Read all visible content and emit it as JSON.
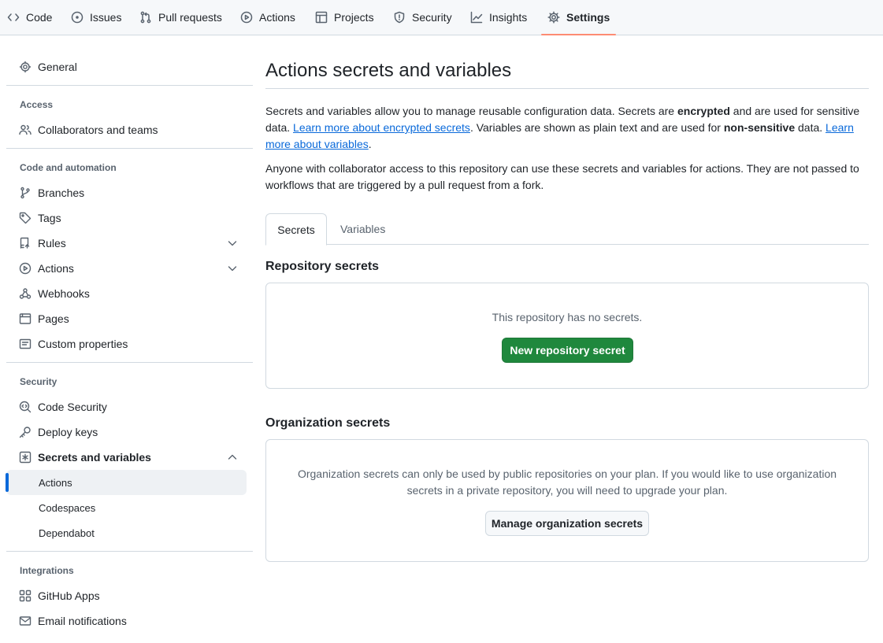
{
  "repo_nav": {
    "tabs": [
      {
        "label": "Code",
        "icon": "code-icon"
      },
      {
        "label": "Issues",
        "icon": "issue-icon"
      },
      {
        "label": "Pull requests",
        "icon": "pull-request-icon"
      },
      {
        "label": "Actions",
        "icon": "play-icon"
      },
      {
        "label": "Projects",
        "icon": "table-icon"
      },
      {
        "label": "Security",
        "icon": "shield-icon"
      },
      {
        "label": "Insights",
        "icon": "graph-icon"
      },
      {
        "label": "Settings",
        "icon": "gear-icon",
        "active": true
      }
    ]
  },
  "sidebar": {
    "general": "General",
    "groups": {
      "access": "Access",
      "code_automation": "Code and automation",
      "security": "Security",
      "integrations": "Integrations"
    },
    "items": {
      "collaborators": "Collaborators and teams",
      "branches": "Branches",
      "tags": "Tags",
      "rules": "Rules",
      "actions": "Actions",
      "webhooks": "Webhooks",
      "pages": "Pages",
      "custom_properties": "Custom properties",
      "code_security": "Code Security",
      "deploy_keys": "Deploy keys",
      "secrets_variables": "Secrets and variables",
      "sub_actions": "Actions",
      "sub_codespaces": "Codespaces",
      "sub_dependabot": "Dependabot",
      "github_apps": "GitHub Apps",
      "email_notifications": "Email notifications"
    }
  },
  "main": {
    "title": "Actions secrets and variables",
    "intro": {
      "t1": "Secrets and variables allow you to manage reusable configuration data. Secrets are ",
      "b1": "encrypted",
      "t2": " and are used for sensitive data. ",
      "link1": "Learn more about encrypted secrets",
      "t3": ". Variables are shown as plain text and are used for ",
      "b2": "non-sensitive",
      "t4": " data. ",
      "link2": "Learn more about variables",
      "t5": "."
    },
    "access_note": "Anyone with collaborator access to this repository can use these secrets and variables for actions. They are not passed to workflows that are triggered by a pull request from a fork.",
    "tabs": {
      "secrets": "Secrets",
      "variables": "Variables"
    },
    "repo_secrets": {
      "heading": "Repository secrets",
      "empty": "This repository has no secrets.",
      "button": "New repository secret"
    },
    "org_secrets": {
      "heading": "Organization secrets",
      "message": "Organization secrets can only be used by public repositories on your plan. If you would like to use organization secrets in a private repository, you will need to upgrade your plan.",
      "button": "Manage organization secrets"
    }
  },
  "colors": {
    "accent_link": "#0969da",
    "primary_button": "#1f883d",
    "active_tab_underline": "#fd8c73"
  }
}
